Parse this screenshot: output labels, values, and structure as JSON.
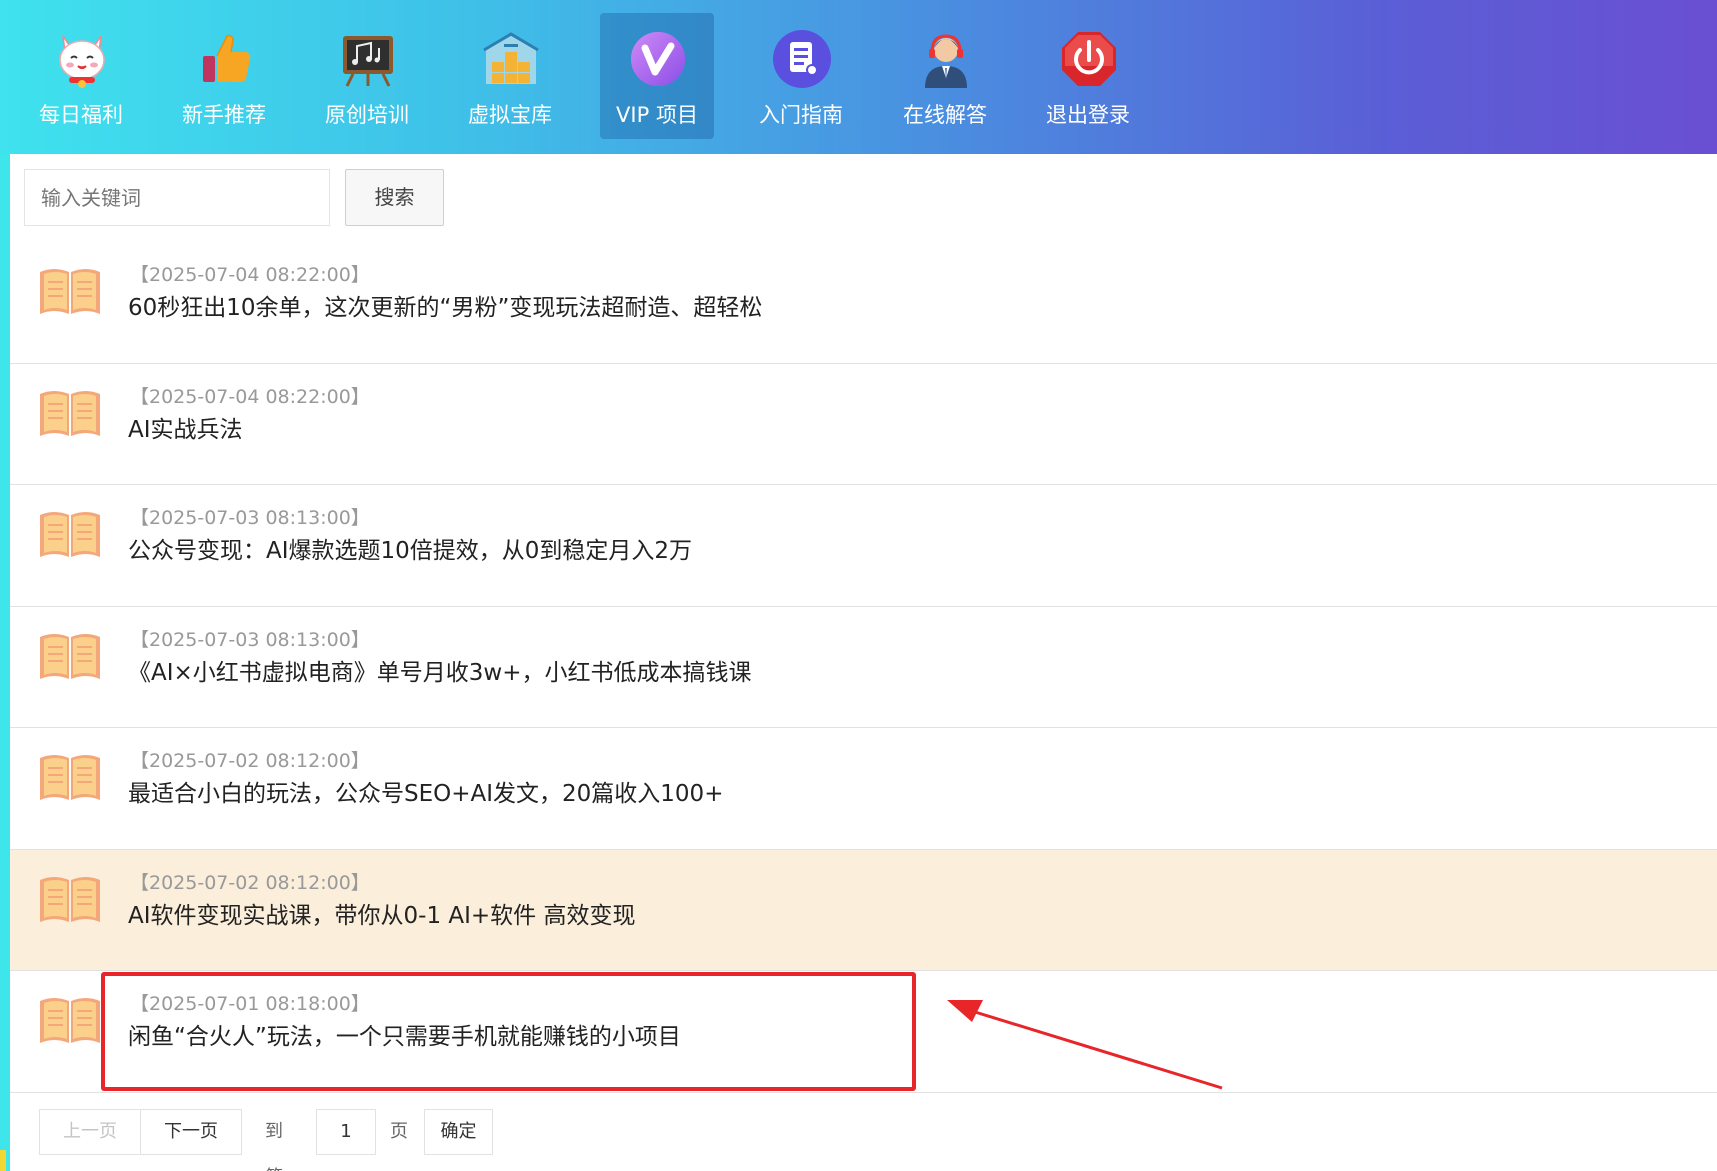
{
  "nav": {
    "items": [
      {
        "label": "每日福利",
        "icon": "lucky-cat-icon"
      },
      {
        "label": "新手推荐",
        "icon": "thumbs-up-icon"
      },
      {
        "label": "原创培训",
        "icon": "music-board-icon"
      },
      {
        "label": "虚拟宝库",
        "icon": "warehouse-icon"
      },
      {
        "label": "VIP 项目",
        "icon": "vip-icon",
        "active": true
      },
      {
        "label": "入门指南",
        "icon": "document-icon"
      },
      {
        "label": "在线解答",
        "icon": "support-agent-icon"
      },
      {
        "label": "退出登录",
        "icon": "power-icon"
      }
    ]
  },
  "search": {
    "placeholder": "输入关键词",
    "button_label": "搜索"
  },
  "list": {
    "items": [
      {
        "date": "【2025-07-04 08:22:00】",
        "title": "60秒狂出10余单，这次更新的“男粉”变现玩法超耐造、超轻松"
      },
      {
        "date": "【2025-07-04 08:22:00】",
        "title": "AI实战兵法"
      },
      {
        "date": "【2025-07-03 08:13:00】",
        "title": "公众号变现：AI爆款选题10倍提效，从0到稳定月入2万"
      },
      {
        "date": "【2025-07-03 08:13:00】",
        "title": "《AI×小红书虚拟电商》单号月收3w+，小红书低成本搞钱课"
      },
      {
        "date": "【2025-07-02 08:12:00】",
        "title": "最适合小白的玩法，公众号SEO+AI发文，20篇收入100+"
      },
      {
        "date": "【2025-07-02 08:12:00】",
        "title": "AI软件变现实战课，带你从0-1 AI+软件 高效变现",
        "highlighted": true
      },
      {
        "date": "【2025-07-01 08:18:00】",
        "title": "闲鱼“合火人”玩法，一个只需要手机就能赚钱的小项目"
      }
    ]
  },
  "pager": {
    "prev_label": "上一页",
    "next_label": "下一页",
    "goto_label": "到第",
    "page_value": "1",
    "page_unit": "页",
    "confirm_label": "确定"
  },
  "colors": {
    "highlight_row": "#fbeedb",
    "annotation": "#e8262a"
  }
}
